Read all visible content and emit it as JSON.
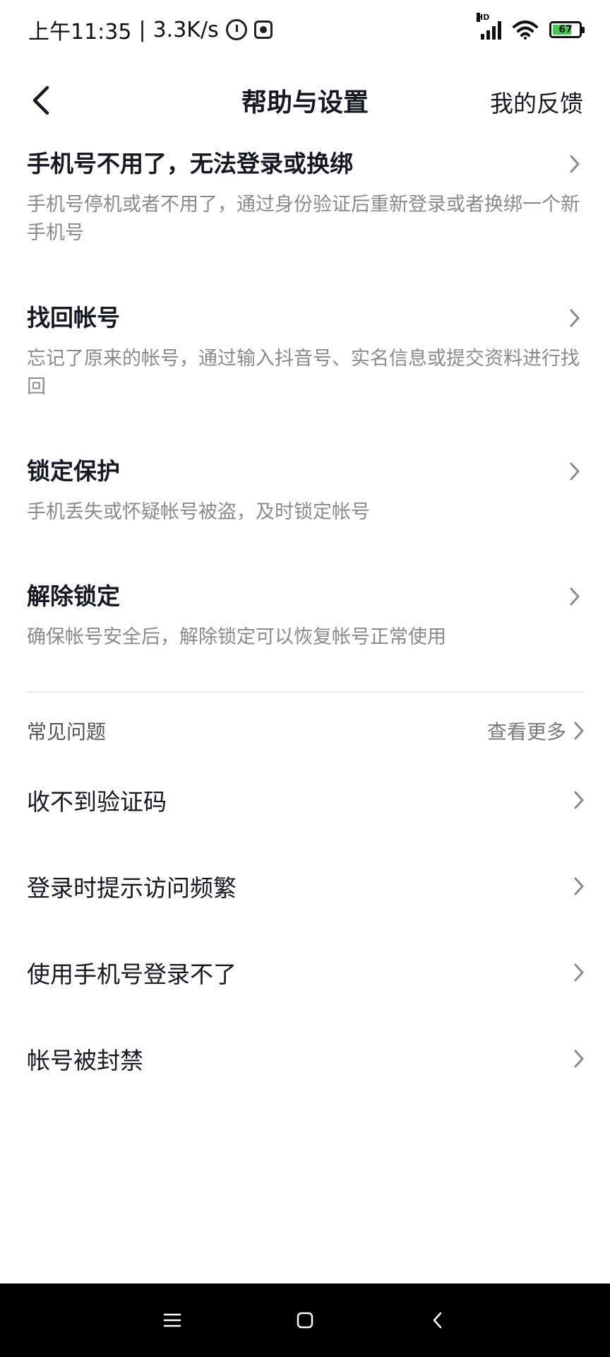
{
  "status_bar": {
    "time": "上午11:35",
    "separator": "|",
    "net_speed": "3.3K/s",
    "network_label": "HD",
    "battery": "67"
  },
  "header": {
    "title": "帮助与设置",
    "feedback": "我的反馈"
  },
  "options": [
    {
      "title": "手机号不用了，无法登录或换绑",
      "desc": "手机号停机或者不用了，通过身份验证后重新登录或者换绑一个新手机号"
    },
    {
      "title": "找回帐号",
      "desc": "忘记了原来的帐号，通过输入抖音号、实名信息或提交资料进行找回"
    },
    {
      "title": "锁定保护",
      "desc": "手机丢失或怀疑帐号被盗，及时锁定帐号"
    },
    {
      "title": "解除锁定",
      "desc": "确保帐号安全后，解除锁定可以恢复帐号正常使用"
    }
  ],
  "faq": {
    "title": "常见问题",
    "see_more": "查看更多",
    "items": [
      "收不到验证码",
      "登录时提示访问频繁",
      "使用手机号登录不了",
      "帐号被封禁"
    ]
  }
}
